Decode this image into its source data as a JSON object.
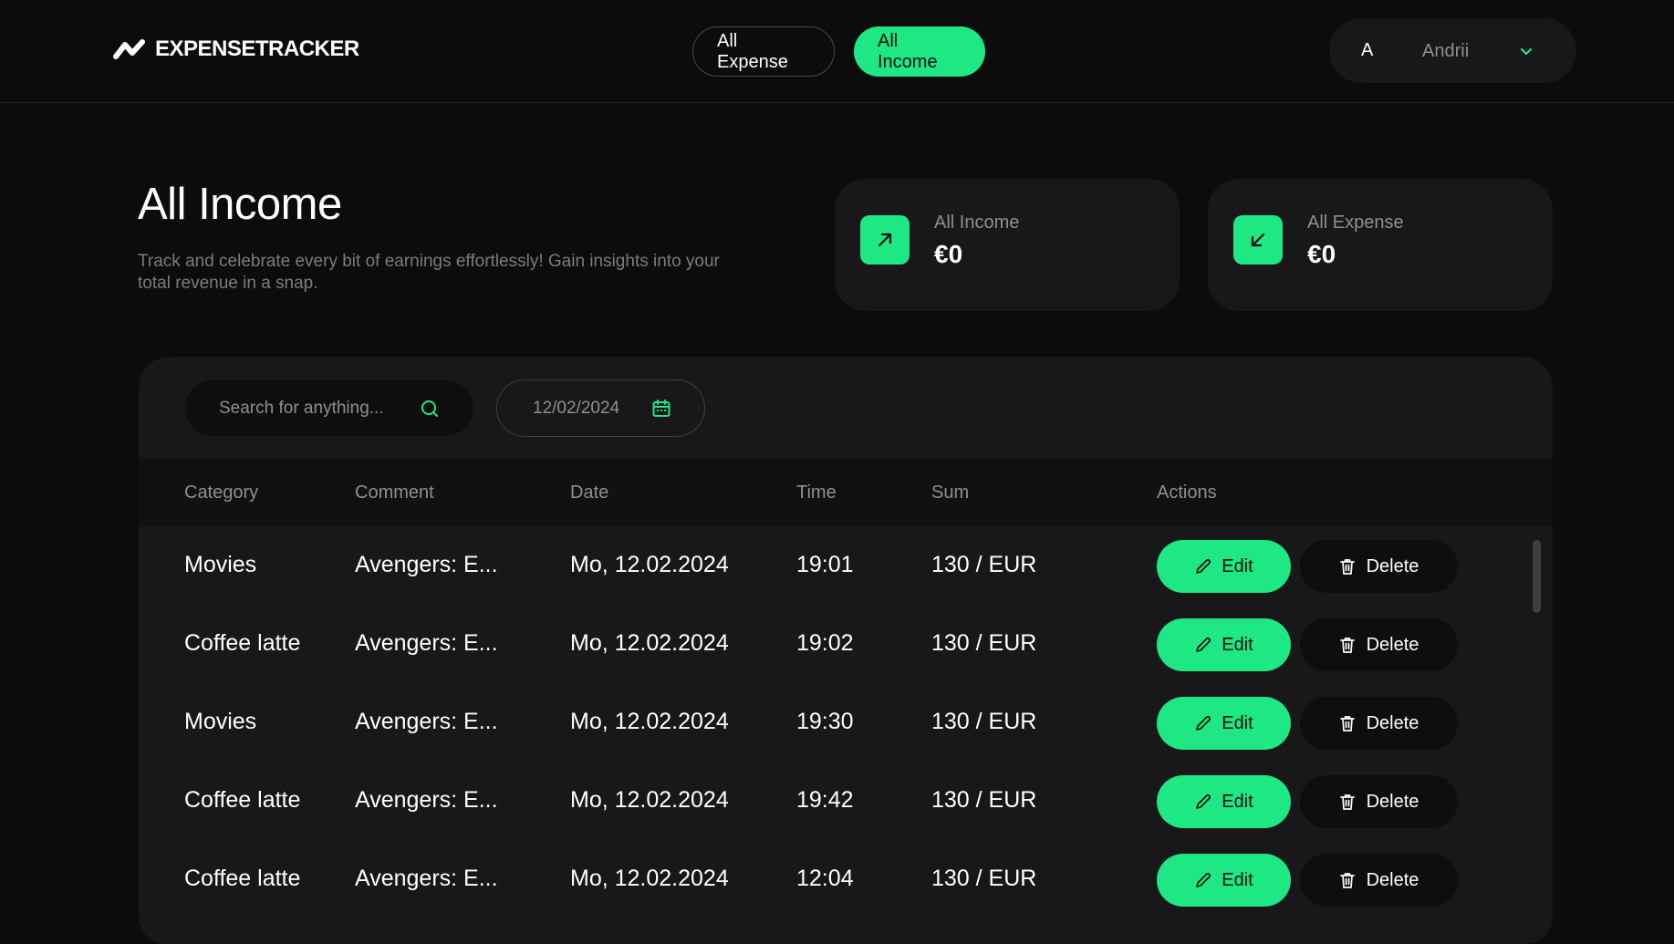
{
  "brand": {
    "name": "EXPENSETRACKER",
    "logo_icon": "zigzag-logo-icon"
  },
  "nav": {
    "all_expense": "All Expense",
    "all_income": "All Income",
    "active": "All Income"
  },
  "user": {
    "avatar_letter": "A",
    "name": "Andrii",
    "menu_icon": "chevron-down-icon"
  },
  "page": {
    "title": "All Income",
    "subtitle": "Track and celebrate every bit of earnings effortlessly! Gain insights into your total revenue in a snap."
  },
  "stats": {
    "income": {
      "label": "All Income",
      "value": "€0",
      "icon": "arrow-up-right-icon"
    },
    "expense": {
      "label": "All Expense",
      "value": "€0",
      "icon": "arrow-down-left-icon"
    }
  },
  "filters": {
    "search_placeholder": "Search for anything...",
    "date": "12/02/2024"
  },
  "table": {
    "headers": {
      "category": "Category",
      "comment": "Comment",
      "date": "Date",
      "time": "Time",
      "sum": "Sum",
      "actions": "Actions"
    },
    "edit_label": "Edit",
    "delete_label": "Delete",
    "rows": [
      {
        "category": "Movies",
        "comment": "Avengers: E...",
        "date": "Mo, 12.02.2024",
        "time": "19:01",
        "sum": "130 / EUR"
      },
      {
        "category": "Coffee latte",
        "comment": "Avengers: E...",
        "date": "Mo, 12.02.2024",
        "time": "19:02",
        "sum": "130 / EUR"
      },
      {
        "category": "Movies",
        "comment": "Avengers: E...",
        "date": "Mo, 12.02.2024",
        "time": "19:30",
        "sum": "130 / EUR"
      },
      {
        "category": "Coffee latte",
        "comment": "Avengers: E...",
        "date": "Mo, 12.02.2024",
        "time": "19:42",
        "sum": "130 / EUR"
      },
      {
        "category": "Coffee latte",
        "comment": "Avengers: E...",
        "date": "Mo, 12.02.2024",
        "time": "12:04",
        "sum": "130 / EUR"
      }
    ]
  },
  "colors": {
    "accent": "#1ee884",
    "background": "#0c0c0d",
    "panel": "#18181a",
    "muted": "#8f8f93"
  }
}
